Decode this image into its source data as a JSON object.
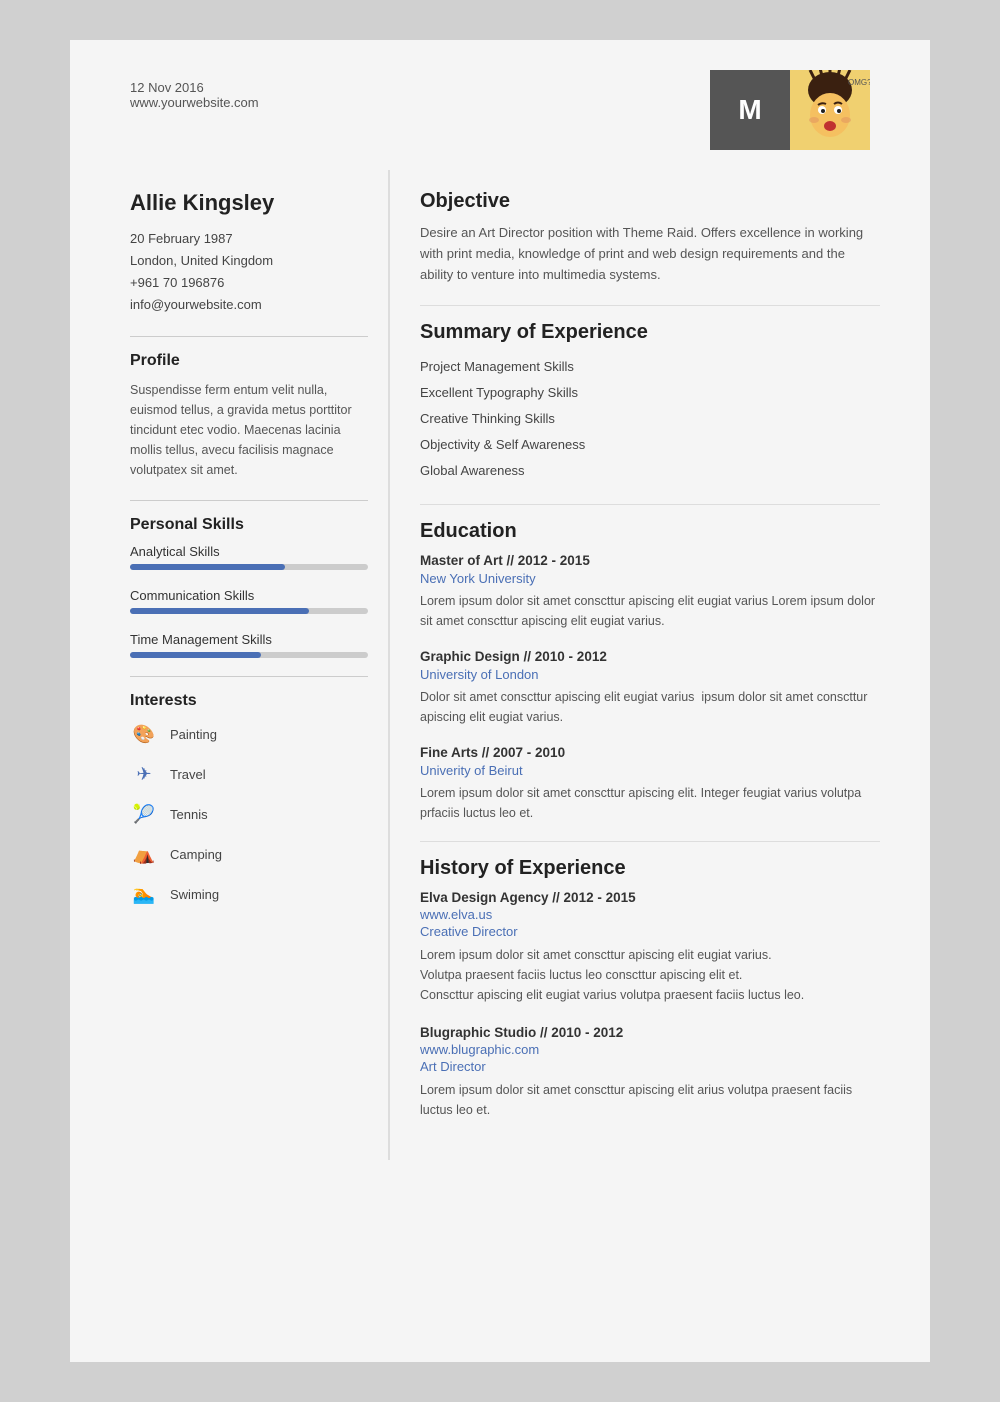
{
  "header": {
    "date": "12 Nov 2016",
    "website": "www.yourwebsite.com",
    "avatar_letter": "M"
  },
  "left": {
    "name": "Allie Kingsley",
    "contact": {
      "dob": "20 February 1987",
      "location": "London, United Kingdom",
      "phone": "+961 70 196876",
      "email": "info@yourwebsite.com"
    },
    "profile_title": "Profile",
    "profile_text": "Suspendisse ferm entum velit nulla, euismod tellus, a gravida metus porttitor tincidunt etec vodio. Maecenas lacinia mollis tellus, avecu facilisis magnace volutpatex sit amet.",
    "skills_title": "Personal Skills",
    "skills": [
      {
        "label": "Analytical Skills",
        "percent": 65
      },
      {
        "label": "Communication Skills",
        "percent": 75
      },
      {
        "label": "Time Management Skills",
        "percent": 55
      }
    ],
    "interests_title": "Interests",
    "interests": [
      {
        "label": "Painting",
        "icon": "🎨"
      },
      {
        "label": "Travel",
        "icon": "✈"
      },
      {
        "label": "Tennis",
        "icon": "🎾"
      },
      {
        "label": "Camping",
        "icon": "⛺"
      },
      {
        "label": "Swiming",
        "icon": "🏊"
      }
    ]
  },
  "right": {
    "objective_title": "Objective",
    "objective_text": "Desire an Art Director position with Theme Raid. Offers excellence in working with print media, knowledge of print and web design requirements and the ability to venture into multimedia systems.",
    "summary_title": "Summary of Experience",
    "summary_items": [
      "Project Management Skills",
      "Excellent Typography Skills",
      "Creative Thinking Skills",
      "Objectivity & Self Awareness",
      "Global Awareness"
    ],
    "education_title": "Education",
    "education": [
      {
        "degree": "Master of Art // 2012 - 2015",
        "school": "New York University",
        "desc": "Lorem ipsum dolor sit amet conscttur apiscing elit eugiat varius Lorem ipsum dolor sit amet conscttur apiscing elit eugiat varius."
      },
      {
        "degree": "Graphic Design // 2010 - 2012",
        "school": "University of London",
        "desc": "Dolor sit amet conscttur apiscing elit eugiat varius  ipsum dolor sit amet conscttur apiscing elit eugiat varius."
      },
      {
        "degree": "Fine Arts // 2007 - 2010",
        "school": "Univerity of Beirut",
        "desc": "Lorem ipsum dolor sit amet conscttur apiscing elit. Integer feugiat varius volutpa prfaciis luctus leo et."
      }
    ],
    "history_title": "History of Experience",
    "history": [
      {
        "company": "Elva Design Agency // 2012 - 2015",
        "url": "www.elva.us",
        "title": "Creative Director",
        "desc": "Lorem ipsum dolor sit amet conscttur apiscing elit eugiat varius.\nVolutpa praesent faciis luctus leo conscttur apiscing elit et.\nConscttur apiscing elit eugiat varius volutpa praesent faciis luctus leo."
      },
      {
        "company": "Blugraphic Studio // 2010 - 2012",
        "url": "www.blugraphic.com",
        "title": "Art Director",
        "desc": "Lorem ipsum dolor sit amet conscttur apiscing elit arius volutpa praesent faciis luctus leo et."
      }
    ]
  }
}
